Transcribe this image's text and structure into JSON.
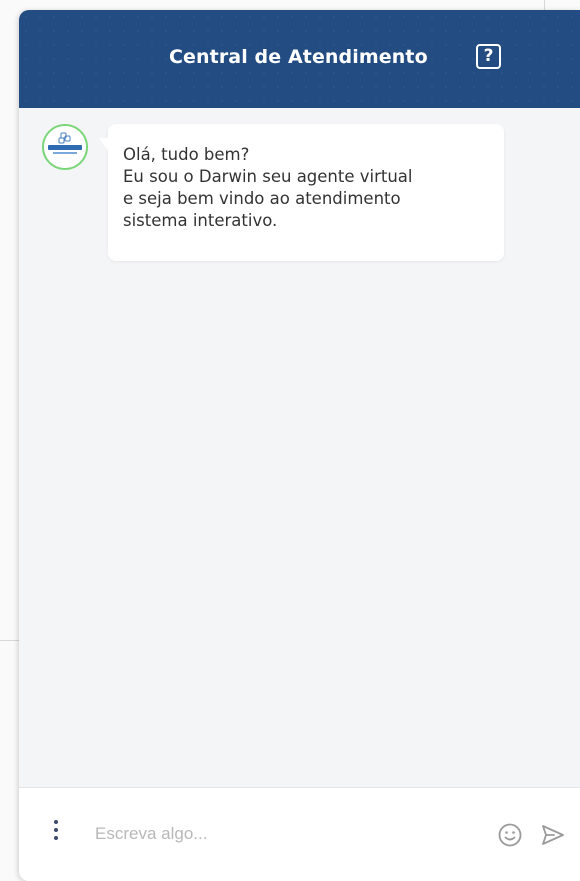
{
  "header": {
    "title": "Central de Atendimento",
    "help_label": "?",
    "background_color": "#234c82"
  },
  "message": {
    "avatar_icon": "support-bot-avatar",
    "lines": [
      "Olá, tudo bem?",
      "Eu sou o Darwin seu agente virtual",
      "e seja bem vindo ao atendimento",
      "sistema interativo."
    ]
  },
  "composer": {
    "placeholder": "Escreva algo...",
    "value": "",
    "menu_icon": "vertical-dots-icon",
    "emoji_icon": "smiley-icon",
    "send_icon": "send-arrow-icon"
  }
}
